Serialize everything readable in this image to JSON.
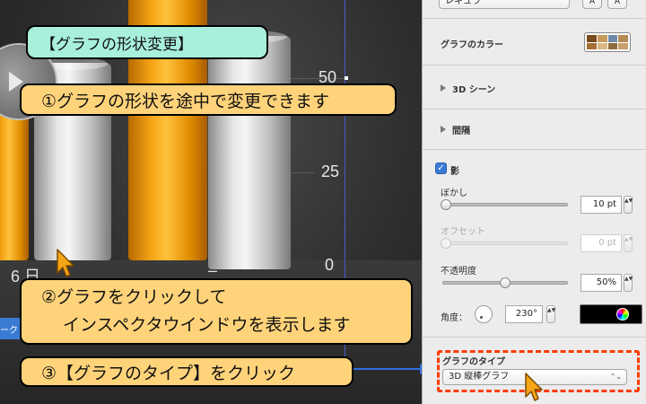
{
  "chart": {
    "ticks": [
      "50",
      "25",
      "0"
    ],
    "label_6": "6 日",
    "label_dash": "–",
    "chip_label": "ーク"
  },
  "callouts": {
    "title": "【グラフの形状変更】",
    "step1": "①グラフの形状を途中で変更できます",
    "step2_line1": "②グラフをクリックして",
    "step2_line2": "インスペクタウインドウを表示します",
    "step3": "③【グラフのタイプ】をクリック"
  },
  "inspector": {
    "top_select": "レギュラ",
    "btn_a1": "A",
    "btn_a2": "A",
    "chart_colors_label": "グラフのカラー",
    "swatch_colors": [
      "#7a4a1f",
      "#c59a5a",
      "#6e8aa8",
      "#b58a52",
      "#a56f35",
      "#d8b884",
      "#8f6a3d",
      "#c9a06a"
    ],
    "scene_3d_label": "3D シーン",
    "spacing_label": "間隔",
    "shadow_label": "影",
    "shadow_checked": "✓",
    "blur_label": "ぼかし",
    "blur_value": "10 pt",
    "offset_label": "オフセット",
    "offset_value": "0 pt",
    "opacity_label": "不透明度",
    "opacity_value": "50%",
    "angle_label": "角度：",
    "angle_value": "230°",
    "chart_type_label": "グラフのタイプ",
    "chart_type_value": "3D 縦棒グラフ",
    "chart_type_caret": "⌃⌄",
    "stepper_glyph": "▲▼"
  },
  "colors": {
    "callout_green": "#a8f0dc",
    "callout_yellow": "#ffd37a",
    "highlight_dashed": "#ff3b00",
    "arrow_blue": "#2f6fe0",
    "cursor_orange": "#f6a516"
  }
}
